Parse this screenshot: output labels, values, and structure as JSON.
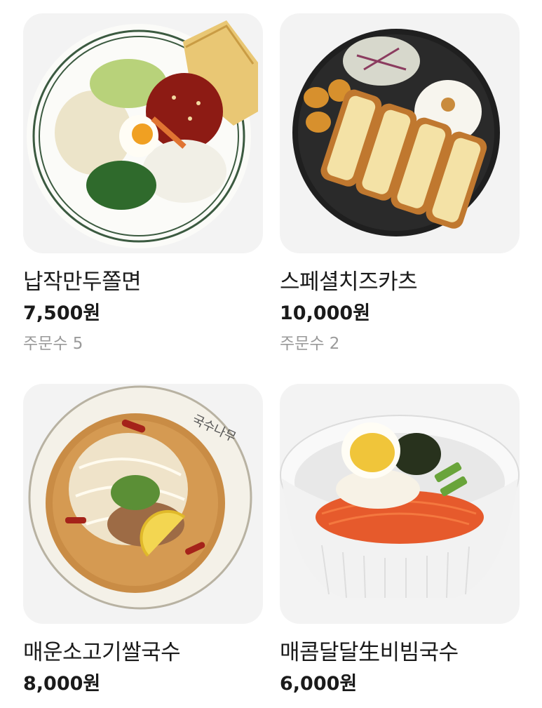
{
  "items": [
    {
      "name": "납작만두쫄면",
      "price": "7,500원",
      "orders": "주문수 5",
      "image_icon": "jjolmyeon-plate-image"
    },
    {
      "name": "스페셜치즈카츠",
      "price": "10,000원",
      "orders": "주문수 2",
      "image_icon": "cheese-katsu-plate-image"
    },
    {
      "name": "매운소고기쌀국수",
      "price": "8,000원",
      "orders": "",
      "image_icon": "spicy-beef-rice-noodle-image",
      "bowl_text": "국수나무"
    },
    {
      "name": "매콤달달生비빔국수",
      "price": "6,000원",
      "orders": "",
      "image_icon": "bibim-guksu-bowl-image"
    }
  ],
  "colors": {
    "text_primary": "#1a1a1a",
    "text_secondary": "#9a9a9a",
    "thumb_bg": "#f3f3f3"
  }
}
